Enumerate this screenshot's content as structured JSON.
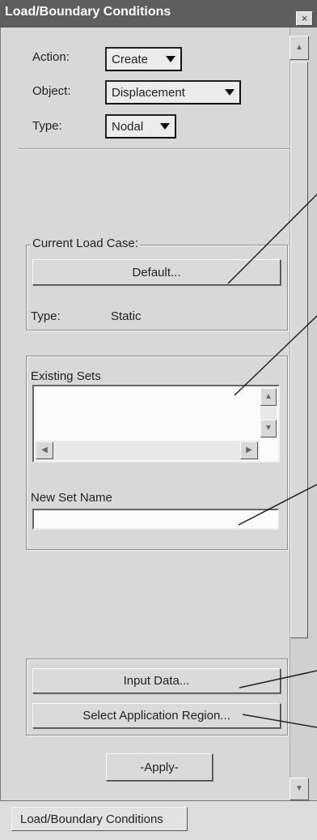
{
  "window": {
    "title": "Load/Boundary Conditions",
    "close_symbol": "×"
  },
  "form": {
    "action": {
      "label": "Action:",
      "value": "Create"
    },
    "object": {
      "label": "Object:",
      "value": "Displacement"
    },
    "type": {
      "label": "Type:",
      "value": "Nodal"
    }
  },
  "load_case": {
    "group_label": "Current Load Case:",
    "button_label": "Default...",
    "type_label": "Type:",
    "type_value": "Static"
  },
  "existing_sets": {
    "label": "Existing Sets",
    "items": []
  },
  "new_set": {
    "label": "New Set Name",
    "value": ""
  },
  "actions": {
    "input_data": "Input Data...",
    "select_region": "Select Application Region...",
    "apply": "-Apply-"
  },
  "bottom_tab": {
    "label": "Load/Boundary Conditions"
  },
  "icons": {
    "scroll_up": "▲",
    "scroll_down": "▼",
    "scroll_left": "◀",
    "scroll_right": "▶"
  }
}
